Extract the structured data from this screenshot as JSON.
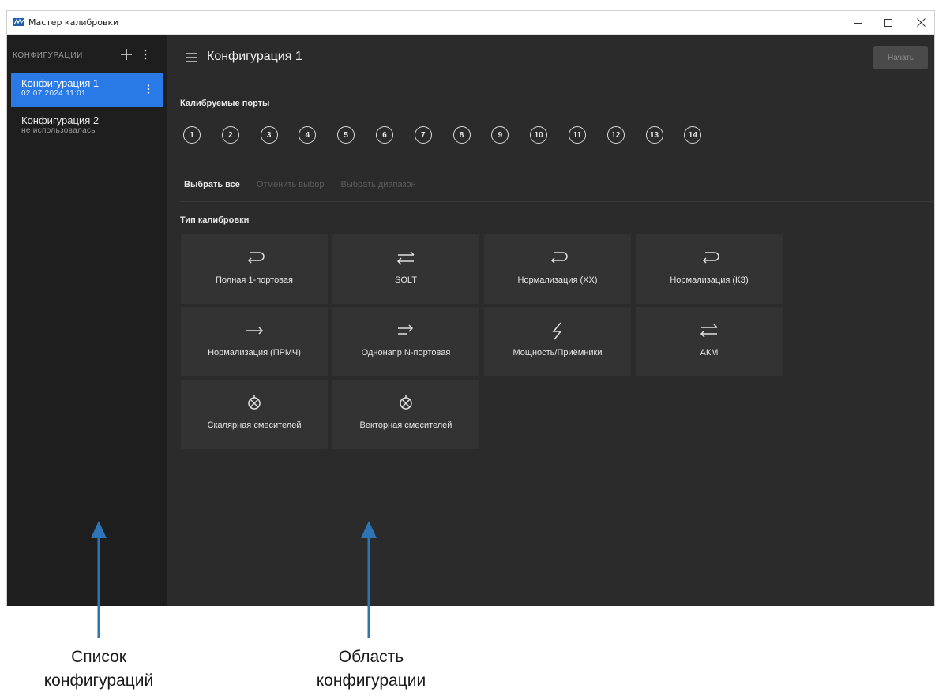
{
  "window": {
    "title": "Мастер калибровки"
  },
  "sidebar": {
    "header_label": "КОНФИГУРАЦИИ",
    "items": [
      {
        "name": "Конфигурация 1",
        "sub": "02.07.2024 11:01",
        "active": true
      },
      {
        "name": "Конфигурация 2",
        "sub": "не использовалась",
        "active": false
      }
    ]
  },
  "main": {
    "title": "Конфигурация 1",
    "start_label": "Начать",
    "ports_label": "Калибруемые порты",
    "ports": [
      "1",
      "2",
      "3",
      "4",
      "5",
      "6",
      "7",
      "8",
      "9",
      "10",
      "11",
      "12",
      "13",
      "14"
    ],
    "select_all": "Выбрать все",
    "deselect": "Отменить выбор",
    "select_range": "Выбрать диапазон",
    "cal_type_label": "Тип калибровки",
    "cal_types": [
      {
        "label": "Полная 1-портовая",
        "icon": "reflect-loop-icon"
      },
      {
        "label": "SOLT",
        "icon": "two-way-arrows-icon"
      },
      {
        "label": "Нормализация (ХХ)",
        "icon": "reflect-loop-icon"
      },
      {
        "label": "Нормализация (КЗ)",
        "icon": "reflect-loop-icon"
      },
      {
        "label": "Нормализация (ПРМЧ)",
        "icon": "right-arrow-icon"
      },
      {
        "label": "Однонапр N-портовая",
        "icon": "one-way-two-arrows-icon"
      },
      {
        "label": "Мощность/Приёмники",
        "icon": "lightning-icon"
      },
      {
        "label": "АКМ",
        "icon": "two-way-arrows-icon"
      },
      {
        "label": "Скалярная смесителей",
        "icon": "mixer-icon"
      },
      {
        "label": "Векторная смесителей",
        "icon": "mixer-icon"
      }
    ]
  },
  "annotations": {
    "left_line1": "Список",
    "left_line2": "конфигураций",
    "right_line1": "Область",
    "right_line2": "конфигурации"
  },
  "colors": {
    "accent": "#2979e6",
    "arrow": "#2e75b6"
  }
}
